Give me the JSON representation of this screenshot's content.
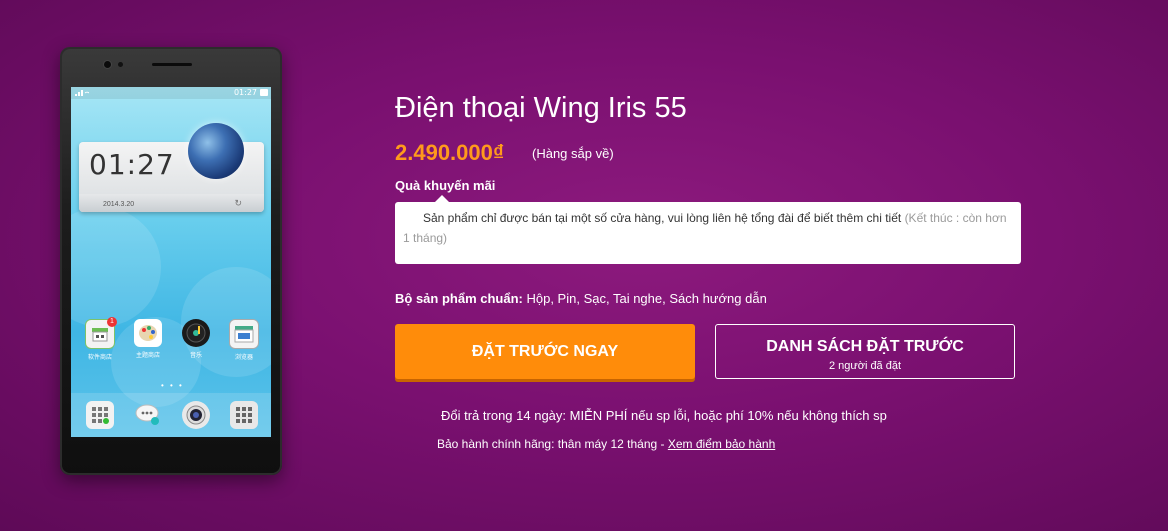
{
  "product": {
    "title": "Điện thoại Wing Iris 55",
    "price": "2.490.000₫",
    "price_note": "(Hàng sắp về)",
    "promo_label": "Quà khuyến mãi",
    "promo_text": "Sản phẩm chỉ được bán tại một số cửa hàng, vui lòng liên hệ tổng đài để biết thêm chi tiết",
    "promo_end": "(Kết thúc : còn hơn 1 tháng)",
    "standard_kit_label": "Bộ sản phẩm chuẩn:",
    "standard_kit_value": "Hộp, Pin, Sạc, Tai nghe, Sách hướng dẫn"
  },
  "actions": {
    "preorder_label": "ĐẶT TRƯỚC NGAY",
    "preorder_list_label": "DANH SÁCH ĐẶT TRƯỚC",
    "preorder_list_count": "2 người đã đặt"
  },
  "policy": {
    "return_text": "Đổi trả trong 14 ngày: MIỄN PHÍ nếu sp lỗi, hoặc phí 10% nếu không thích sp",
    "warranty_text": "Bảo hành chính hãng: thân máy 12 tháng - ",
    "warranty_link": "Xem điểm bảo hành"
  },
  "phone_screen": {
    "status_time": "01:27",
    "clock": "01:27",
    "date": "2014.3.20",
    "apps": [
      {
        "label": "软件商店",
        "icon": "store-icon",
        "badge": "1"
      },
      {
        "label": "主题商店",
        "icon": "palette-icon"
      },
      {
        "label": "音乐",
        "icon": "music-icon"
      },
      {
        "label": "浏览器",
        "icon": "browser-icon"
      }
    ],
    "dock": [
      {
        "icon": "dialer-icon"
      },
      {
        "icon": "messages-icon"
      },
      {
        "icon": "camera-icon"
      },
      {
        "icon": "app-drawer-icon"
      }
    ]
  },
  "colors": {
    "background": "#7a1070",
    "price": "#ff9a1c",
    "primary_button": "#ff8c0a"
  }
}
